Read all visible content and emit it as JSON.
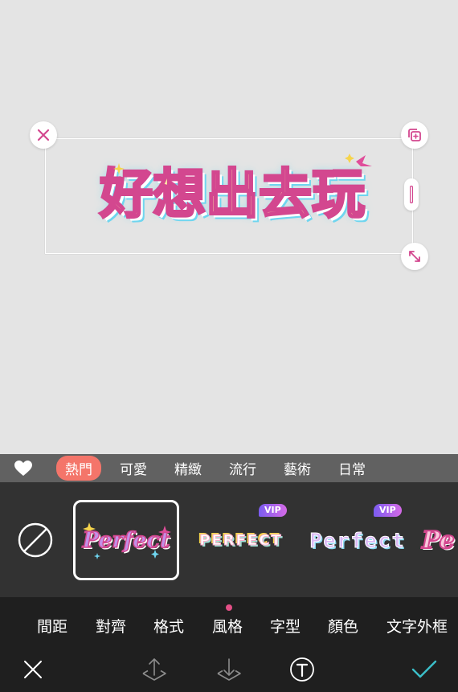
{
  "canvas": {
    "text_content": "好想出去玩",
    "handles": {
      "close": "close-icon",
      "duplicate": "duplicate-icon",
      "resize": "resize-icon",
      "side": "side-stretch-icon"
    }
  },
  "categories": {
    "favorites_icon": "heart-icon",
    "tabs": [
      {
        "label": "熱門",
        "active": true
      },
      {
        "label": "可愛",
        "active": false
      },
      {
        "label": "精緻",
        "active": false
      },
      {
        "label": "流行",
        "active": false
      },
      {
        "label": "藝術",
        "active": false
      },
      {
        "label": "日常",
        "active": false
      }
    ]
  },
  "styles": {
    "none_icon": "no-style-icon",
    "items": [
      {
        "preview_text": "Perfect",
        "vip": false,
        "selected": true
      },
      {
        "preview_text": "PERFECT",
        "vip": true,
        "vip_label": "VIP",
        "selected": false
      },
      {
        "preview_text": "Perfect",
        "vip": true,
        "vip_label": "VIP",
        "selected": false
      },
      {
        "preview_text": "Pe",
        "vip": false,
        "selected": false
      }
    ]
  },
  "tool_tabs": [
    {
      "label": "間距",
      "active": false
    },
    {
      "label": "對齊",
      "active": false
    },
    {
      "label": "格式",
      "active": false
    },
    {
      "label": "風格",
      "active": true
    },
    {
      "label": "字型",
      "active": false
    },
    {
      "label": "顏色",
      "active": false
    },
    {
      "label": "文字外框",
      "active": false
    }
  ],
  "actions": {
    "cancel": "close-icon",
    "layer_up": "bring-forward-icon",
    "layer_down": "send-backward-icon",
    "text": "text-icon",
    "confirm": "checkmark-icon"
  },
  "colors": {
    "accent": "#f4756a",
    "indicator": "#e34f86",
    "confirm": "#3bbfc9",
    "text_fill": "#fde7a6",
    "text_stroke": "#d3478f",
    "text_shadow": "#6fd5ef"
  }
}
